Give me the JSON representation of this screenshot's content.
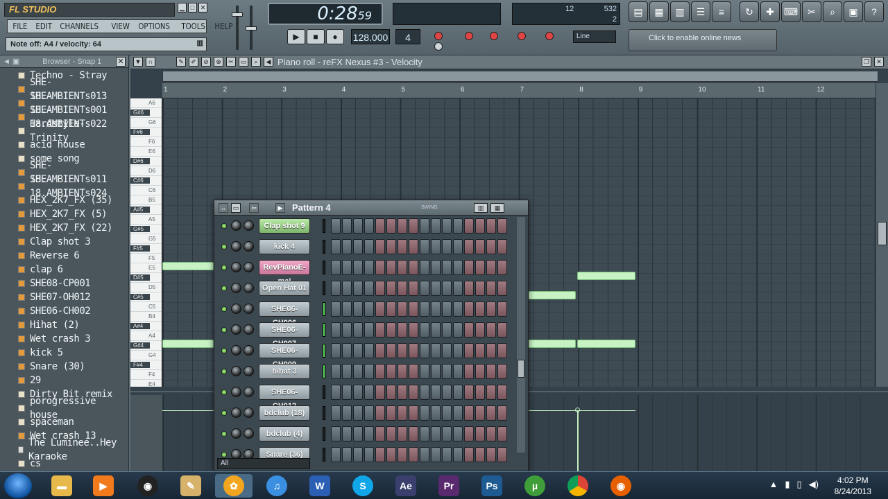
{
  "app": {
    "logo": "FL STUDIO",
    "menu": [
      "FILE",
      "EDIT",
      "CHANNELS",
      "VIEW",
      "OPTIONS",
      "TOOLS",
      "HELP"
    ],
    "hint": "Note off: A4 / velocity: 64",
    "time_main": "0:28",
    "time_sub": "59",
    "tempo": "128.000",
    "pattern_num": "4",
    "snap": "Line",
    "cpu_value": "12",
    "ram_value": "532",
    "poly_value": "2",
    "news": "Click to enable online news"
  },
  "browser": {
    "title": "Browser - Snap 1",
    "items": [
      {
        "label": "Techno - Stray",
        "type": "file"
      },
      {
        "label": "SHE-18.AMBIENTs013",
        "type": "sound"
      },
      {
        "label": "SHE-18.AMBIENTs001",
        "type": "sound"
      },
      {
        "label": "SHE-18.AMBIENTs022",
        "type": "sound"
      },
      {
        "label": "Hardstyle- Trinity",
        "type": "file"
      },
      {
        "label": "acid house",
        "type": "file"
      },
      {
        "label": "some song",
        "type": "file"
      },
      {
        "label": "SHE-18.AMBIENTs011",
        "type": "sound"
      },
      {
        "label": "SHE-18.AMBIENTs024",
        "type": "sound"
      },
      {
        "label": "HEX_2K7_FX (35)",
        "type": "sound"
      },
      {
        "label": "HEX_2K7_FX (5)",
        "type": "sound"
      },
      {
        "label": "HEX_2K7_FX (22)",
        "type": "sound"
      },
      {
        "label": "Clap shot 3",
        "type": "sound"
      },
      {
        "label": "Reverse 6",
        "type": "sound"
      },
      {
        "label": "clap 6",
        "type": "sound"
      },
      {
        "label": "SHE08-CP001",
        "type": "sound"
      },
      {
        "label": "SHE07-OH012",
        "type": "sound"
      },
      {
        "label": "SHE06-CH002",
        "type": "sound"
      },
      {
        "label": "Hihat (2)",
        "type": "sound"
      },
      {
        "label": "Wet crash 3",
        "type": "sound"
      },
      {
        "label": "kick 5",
        "type": "sound"
      },
      {
        "label": "Snare (30)",
        "type": "sound"
      },
      {
        "label": "29",
        "type": "sound"
      },
      {
        "label": "Dirty Bit remix",
        "type": "file"
      },
      {
        "label": "porogressive house",
        "type": "file"
      },
      {
        "label": "spaceman",
        "type": "file"
      },
      {
        "label": "Wet crash 13",
        "type": "sound"
      },
      {
        "label": "The Luminee..Hey Karaoke",
        "type": "gen"
      },
      {
        "label": "cs",
        "type": "file"
      }
    ]
  },
  "piano_roll": {
    "title": "Piano roll - reFX Nexus #3 - Velocity",
    "ruler": [
      "1",
      "2",
      "3",
      "4",
      "5",
      "6",
      "7",
      "8",
      "9",
      "10",
      "11",
      "12"
    ],
    "key_labels": [
      "A6",
      "G#6",
      "G6",
      "F#6",
      "F6",
      "E6",
      "D#6",
      "D6",
      "C#6",
      "C6",
      "B5",
      "A#5",
      "A5",
      "G#5",
      "G5",
      "F#5",
      "F5",
      "E5",
      "D#5",
      "D5",
      "C#5",
      "C5",
      "B4",
      "A#4",
      "A4",
      "G#4",
      "G4",
      "F#4",
      "F4",
      "E4"
    ]
  },
  "sequencer": {
    "title": "Pattern 4",
    "swing_label": "SWING",
    "filter": "All",
    "channels": [
      {
        "name": "Clap shot 9",
        "style": "green"
      },
      {
        "name": "kick 4",
        "style": "normal"
      },
      {
        "name": "RevPianoE-maj",
        "style": "pink"
      },
      {
        "name": "Open Hat 01",
        "style": "normal"
      },
      {
        "name": "SHE06-CH006",
        "style": "normal"
      },
      {
        "name": "SHE06-CH007",
        "style": "normal"
      },
      {
        "name": "SHE06-CH009",
        "style": "normal"
      },
      {
        "name": "hihat 3",
        "style": "normal"
      },
      {
        "name": "SHE06-CH012",
        "style": "normal"
      },
      {
        "name": "bdclub (18)",
        "style": "normal"
      },
      {
        "name": "bdclub (4)",
        "style": "normal"
      },
      {
        "name": "Snare (36)",
        "style": "normal"
      }
    ]
  },
  "taskbar": {
    "time": "4:02 PM",
    "date": "8/24/2013"
  }
}
